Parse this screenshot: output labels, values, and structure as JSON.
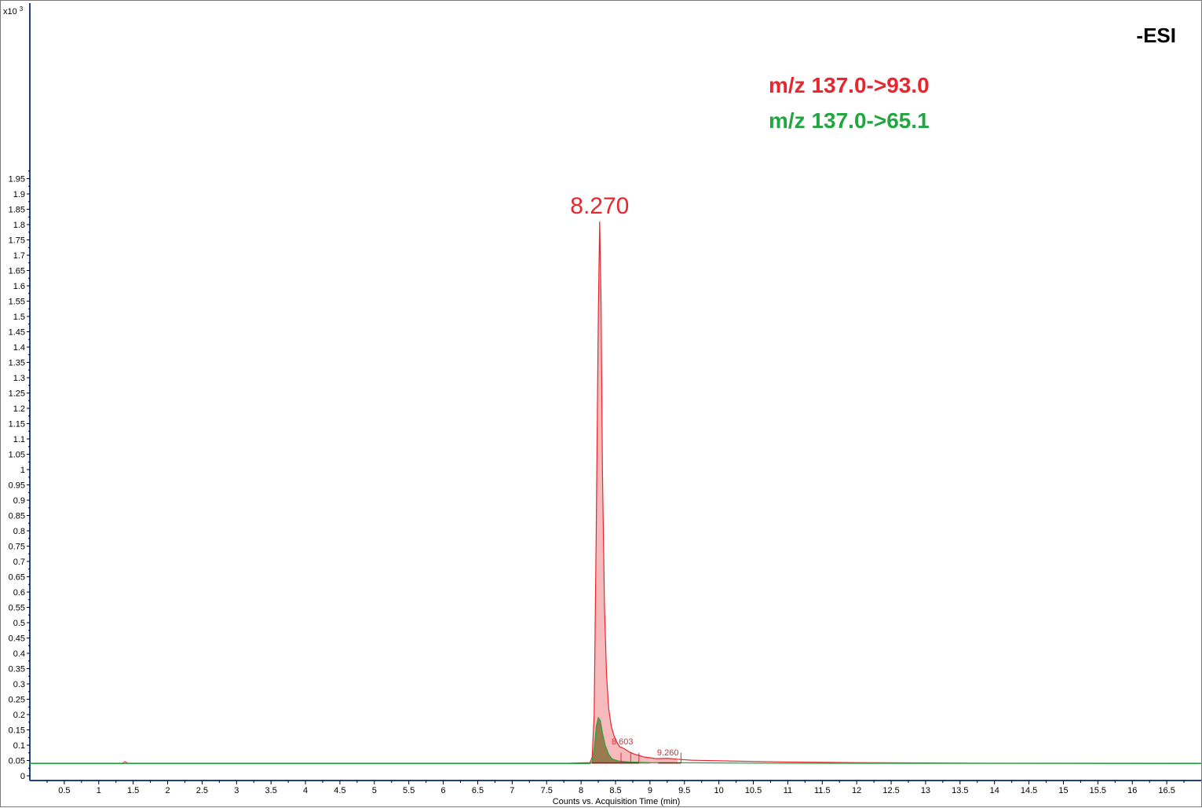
{
  "chart_data": {
    "type": "line",
    "y_multiplier_label": "x10",
    "y_multiplier_exp": "3",
    "xlabel": "Counts vs. Acquisition Time (min)",
    "ylabel": "",
    "xlim": [
      0,
      17
    ],
    "ylim": [
      0,
      2.0
    ],
    "x_ticks": [
      "0.5",
      "1",
      "1.5",
      "2",
      "2.5",
      "3",
      "3.5",
      "4",
      "4.5",
      "5",
      "5.5",
      "6",
      "6.5",
      "7",
      "7.5",
      "8",
      "8.5",
      "9",
      "9.5",
      "10",
      "10.5",
      "11",
      "11.5",
      "12",
      "12.5",
      "13",
      "13.5",
      "14",
      "14.5",
      "15",
      "15.5",
      "16",
      "16.5"
    ],
    "y_ticks": [
      "0",
      "0.05",
      "0.1",
      "0.15",
      "0.2",
      "0.25",
      "0.3",
      "0.35",
      "0.4",
      "0.45",
      "0.5",
      "0.55",
      "0.6",
      "0.65",
      "0.7",
      "0.75",
      "0.8",
      "0.85",
      "0.9",
      "0.95",
      "1",
      "1.05",
      "1.1",
      "1.15",
      "1.2",
      "1.25",
      "1.3",
      "1.35",
      "1.4",
      "1.45",
      "1.5",
      "1.55",
      "1.6",
      "1.65",
      "1.7",
      "1.75",
      "1.8",
      "1.85",
      "1.9",
      "1.95"
    ],
    "ionization": "-ESI",
    "series": [
      {
        "name": "m/z 137.0->93.0",
        "color": "#e8262d",
        "fill": "#f4a3a6",
        "baseline": 0.04,
        "points": [
          [
            0,
            0.041
          ],
          [
            1,
            0.041
          ],
          [
            1.35,
            0.041
          ],
          [
            1.38,
            0.046
          ],
          [
            1.42,
            0.041
          ],
          [
            2,
            0.041
          ],
          [
            4,
            0.041
          ],
          [
            6,
            0.041
          ],
          [
            7,
            0.041
          ],
          [
            7.8,
            0.041
          ],
          [
            8.13,
            0.043
          ],
          [
            8.16,
            0.06
          ],
          [
            8.19,
            0.2
          ],
          [
            8.22,
            0.8
          ],
          [
            8.25,
            1.5
          ],
          [
            8.27,
            1.81
          ],
          [
            8.29,
            1.55
          ],
          [
            8.31,
            1.0
          ],
          [
            8.34,
            0.55
          ],
          [
            8.37,
            0.33
          ],
          [
            8.4,
            0.22
          ],
          [
            8.44,
            0.16
          ],
          [
            8.48,
            0.13
          ],
          [
            8.52,
            0.11
          ],
          [
            8.56,
            0.095
          ],
          [
            8.6,
            0.092
          ],
          [
            8.65,
            0.085
          ],
          [
            8.7,
            0.078
          ],
          [
            8.75,
            0.073
          ],
          [
            8.8,
            0.069
          ],
          [
            8.85,
            0.066
          ],
          [
            8.9,
            0.062
          ],
          [
            9.0,
            0.059
          ],
          [
            9.1,
            0.056
          ],
          [
            9.26,
            0.057
          ],
          [
            9.4,
            0.054
          ],
          [
            9.6,
            0.051
          ],
          [
            10,
            0.049
          ],
          [
            10.5,
            0.047
          ],
          [
            11,
            0.045
          ],
          [
            11.5,
            0.044
          ],
          [
            12,
            0.043
          ],
          [
            13,
            0.042
          ],
          [
            14,
            0.041
          ],
          [
            15,
            0.041
          ],
          [
            16,
            0.041
          ],
          [
            17,
            0.041
          ]
        ]
      },
      {
        "name": "m/z 137.0->65.1",
        "color": "#23a542",
        "fill": "#8a6e3c",
        "baseline": 0.04,
        "points": [
          [
            0,
            0.04
          ],
          [
            7,
            0.04
          ],
          [
            8.13,
            0.04
          ],
          [
            8.16,
            0.045
          ],
          [
            8.19,
            0.09
          ],
          [
            8.22,
            0.16
          ],
          [
            8.25,
            0.19
          ],
          [
            8.28,
            0.18
          ],
          [
            8.31,
            0.14
          ],
          [
            8.35,
            0.1
          ],
          [
            8.4,
            0.07
          ],
          [
            8.45,
            0.055
          ],
          [
            8.55,
            0.048
          ],
          [
            8.7,
            0.045
          ],
          [
            9.0,
            0.043
          ],
          [
            10,
            0.042
          ],
          [
            11,
            0.041
          ],
          [
            17,
            0.04
          ]
        ]
      }
    ],
    "peak_labels": [
      {
        "label": "8.270",
        "x": 8.27,
        "y": 1.81,
        "size": "large",
        "color": "#e8262d"
      },
      {
        "label": "8.603",
        "x": 8.6,
        "y": 0.092,
        "size": "small",
        "color": "#e8262d"
      },
      {
        "label": "9.260",
        "x": 9.26,
        "y": 0.057,
        "size": "small",
        "color": "#e8262d"
      }
    ],
    "integration_segments": [
      {
        "color": "#e8262d",
        "x_from": 8.16,
        "x_to": 8.58
      },
      {
        "color": "#e8262d",
        "x_from": 8.58,
        "x_to": 8.72
      },
      {
        "color": "#e8262d",
        "x_from": 8.72,
        "x_to": 8.84
      },
      {
        "color": "#e8262d",
        "x_from": 9.12,
        "x_to": 9.45
      }
    ],
    "legend": {
      "placement": "top-right",
      "entries": [
        {
          "text": "m/z 137.0->93.0",
          "color": "#e8262d"
        },
        {
          "text": "m/z 137.0->65.1",
          "color": "#23a542"
        }
      ]
    },
    "grid": false
  }
}
